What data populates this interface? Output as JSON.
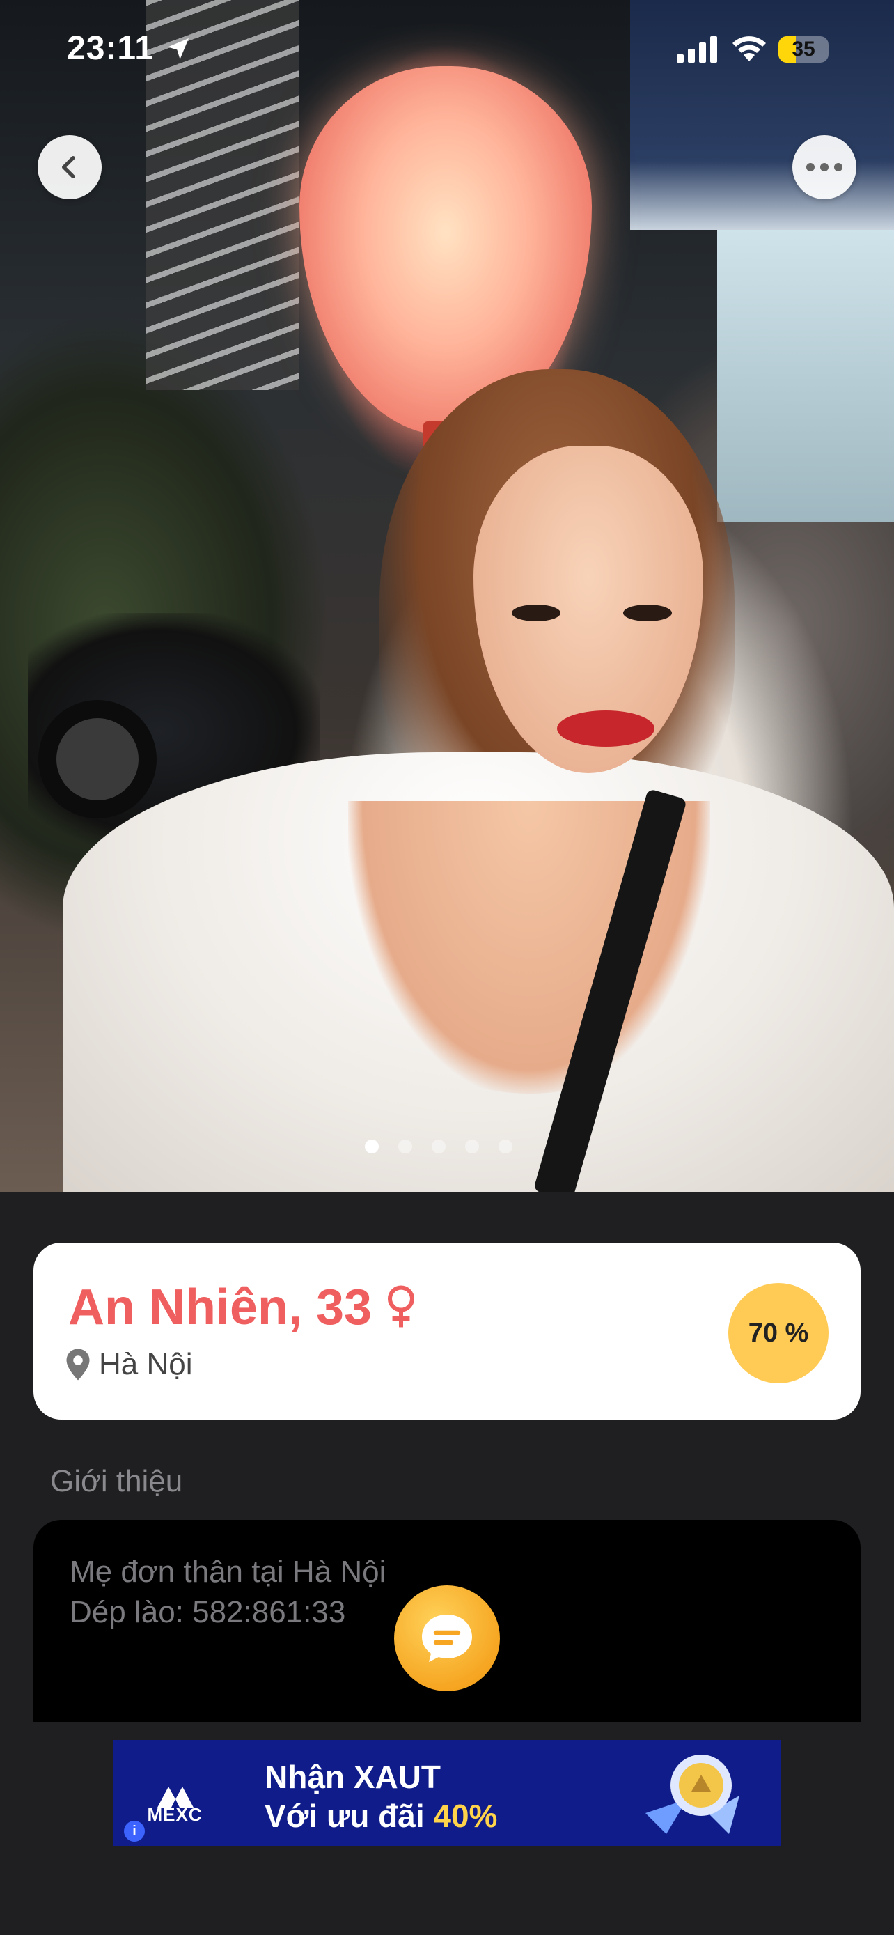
{
  "status_bar": {
    "time": "23:11",
    "battery_level": "35",
    "battery_percent": 35
  },
  "photo_gallery": {
    "page_count": 5,
    "active_index": 0
  },
  "profile": {
    "name_age": "An Nhiên, 33",
    "gender_symbol": "♀",
    "location": "Hà Nội",
    "match_percent": "70 %"
  },
  "intro": {
    "heading": "Giới thiệu",
    "bio_line1": "Mẹ đơn thân tại Hà Nội",
    "bio_line2": "Dép lào: 582:861:33"
  },
  "ad": {
    "brand": "MEXC",
    "line1": "Nhận XAUT",
    "line2_prefix": "Với ưu đãi ",
    "line2_highlight": "40%"
  },
  "colors": {
    "background": "#1f1f21",
    "name_accent": "#ef5f5f",
    "match_badge": "#ffcb55",
    "chat_fab": "#f6a622",
    "ad_background": "#0f1c8a",
    "ad_highlight": "#ffd34a"
  },
  "icons": {
    "back": "chevron-left-icon",
    "more": "ellipsis-icon",
    "location": "map-pin-icon",
    "chat": "chat-bubble-icon",
    "gender": "female-icon"
  }
}
